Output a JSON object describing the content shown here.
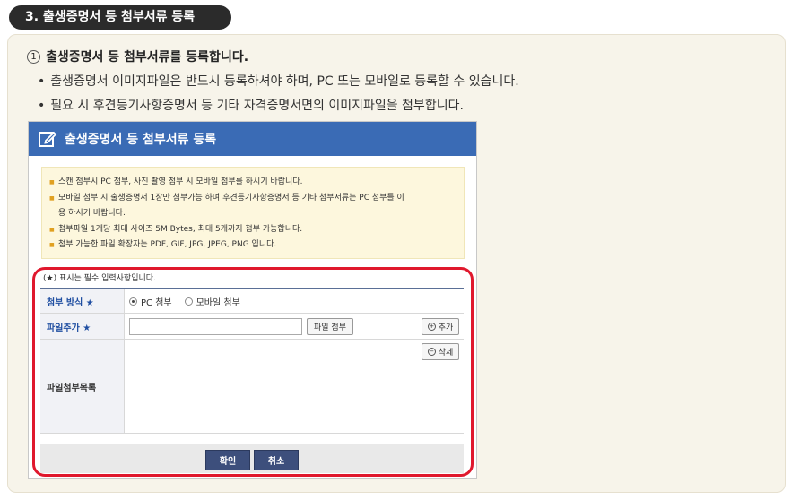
{
  "section_title": "3. 출생증명서 등 첨부서류 등록",
  "step": {
    "number": "1",
    "heading": "출생증명서 등 첨부서류를 등록합니다."
  },
  "bullets": [
    "출생증명서 이미지파일은 반드시 등록하셔야 하며, PC 또는 모바일로 등록할 수 있습니다.",
    "필요 시 후견등기사항증명서 등 기타 자격증명서면의 이미지파일을 첨부합니다."
  ],
  "dialog": {
    "title": "출생증명서 등 첨부서류 등록",
    "notices": [
      "스캔 첨부시 PC 첨부, 사진 촬영 첨부 시 모바일 첨부를 하시기 바랍니다.",
      "모바일 첨부 시 출생증명서 1장만 첨부가능 하며 후견등기사항증명서 등 기타 첨부서류는 PC 첨부를 이",
      "용 하시기 바랍니다.",
      "첨부파일 1개당 최대 사이즈 5M Bytes, 최대 5개까지 첨부 가능합니다.",
      "첨부 가능한 파일 확장자는 PDF, GIF, JPG, JPEG, PNG 입니다."
    ],
    "required_note": "(★) 표시는 필수 입력사항입니다.",
    "form": {
      "method_label": "첨부 방식 ★",
      "method_options": [
        "PC 첨부",
        "모바일 첨부"
      ],
      "method_selected": "PC 첨부",
      "file_add_label": "파일추가 ★",
      "file_input_value": "",
      "attach_button": "파일 첨부",
      "add_button": "추가",
      "list_label": "파일첨부목록",
      "delete_button": "삭제"
    },
    "confirm_button": "확인",
    "cancel_button": "취소"
  },
  "colors": {
    "header_blue": "#3a6bb5",
    "highlight_red": "#e0182d",
    "notice_bg": "#fdf7dd",
    "button_navy": "#3d4f7c"
  },
  "icons": {
    "title_icon": "edit-icon",
    "add_icon": "plus-circle-icon",
    "delete_icon": "minus-circle-icon"
  }
}
